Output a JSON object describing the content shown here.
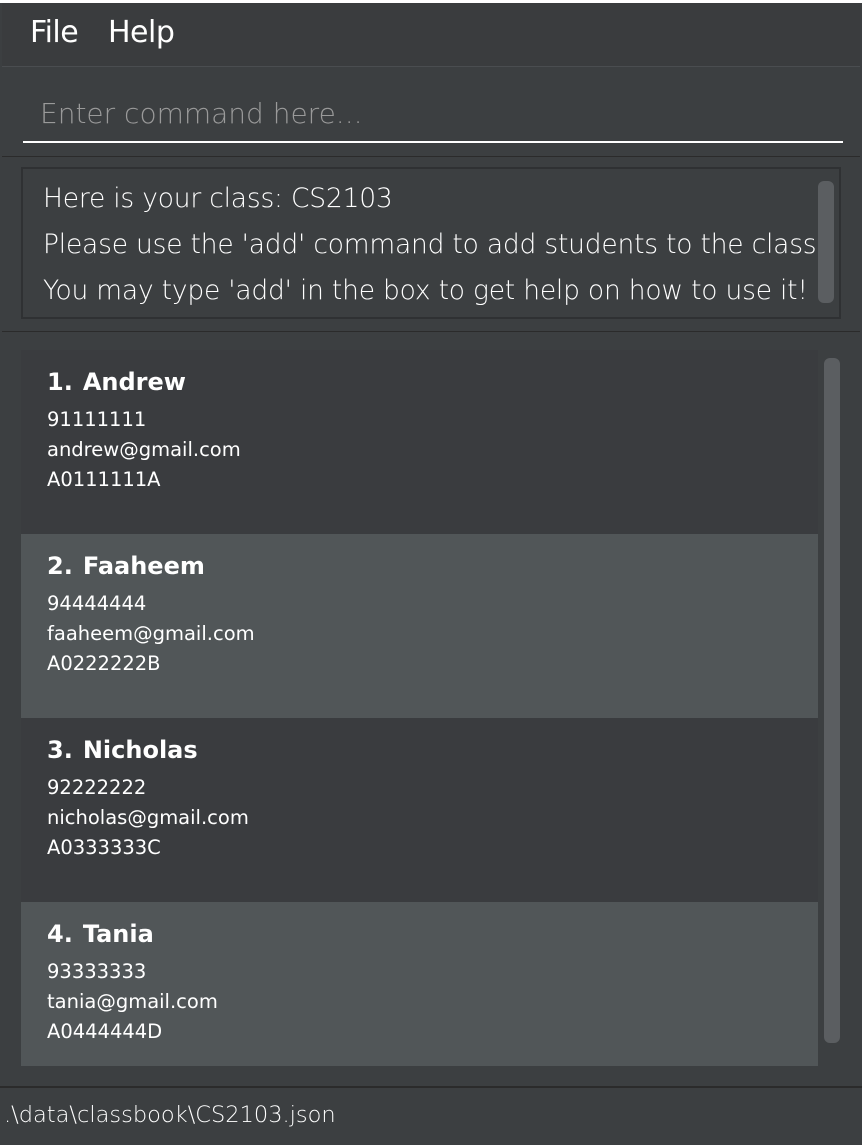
{
  "menu": {
    "file_label": "File",
    "help_label": "Help"
  },
  "command": {
    "placeholder": "Enter command here...",
    "value": ""
  },
  "result": {
    "lines": [
      "Here is your class: CS2103",
      "Please use the 'add' command to add students to the class.",
      "You may type 'add' in the box to get help on how to use it!"
    ]
  },
  "students": [
    {
      "index": "1.",
      "name": "Andrew",
      "phone": "91111111",
      "email": "andrew@gmail.com",
      "student_id": "A0111111A"
    },
    {
      "index": "2.",
      "name": "Faaheem",
      "phone": "94444444",
      "email": "faaheem@gmail.com",
      "student_id": "A0222222B"
    },
    {
      "index": "3.",
      "name": "Nicholas",
      "phone": "92222222",
      "email": "nicholas@gmail.com",
      "student_id": "A0333333C"
    },
    {
      "index": "4.",
      "name": "Tania",
      "phone": "93333333",
      "email": "tania@gmail.com",
      "student_id": "A0444444D"
    }
  ],
  "status": {
    "file_path": ".\\data\\classbook\\CS2103.json"
  },
  "colors": {
    "background": "#3c3f41",
    "card_dark": "#3a3c3f",
    "card_light": "#515658",
    "scrollbar": "#5b5e61",
    "text": "#ffffff"
  }
}
